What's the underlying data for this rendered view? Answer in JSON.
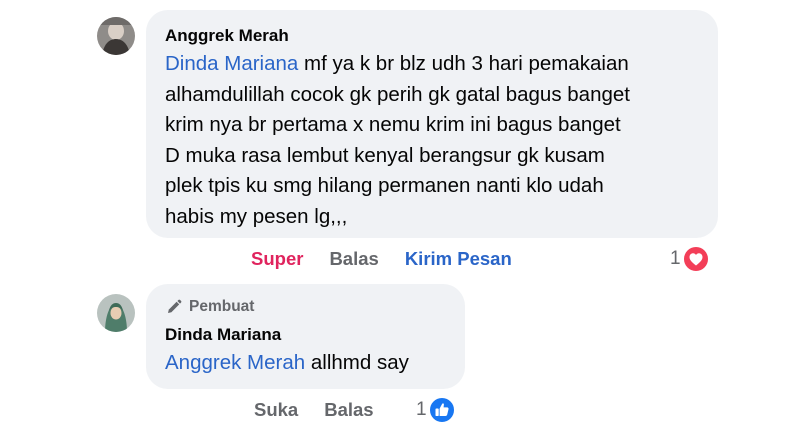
{
  "comment1": {
    "author": "Anggrek Merah",
    "mention": "Dinda Mariana",
    "lines": [
      "mf ya k br blz udh 3 hari pemakaian",
      "alhamdulillah cocok gk perih gk gatal bagus banget",
      "krim nya br pertama x nemu krim ini bagus banget",
      "D muka rasa lembut kenyal berangsur gk kusam",
      "plek tpis ku smg hilang permanen nanti klo udah",
      "habis my pesen lg,,,"
    ],
    "actions": {
      "react_label": "Super",
      "reply_label": "Balas",
      "message_label": "Kirim Pesan"
    },
    "reaction_count": "1",
    "reaction_icon": "heart-icon",
    "reaction_color": "#f33e58"
  },
  "comment2": {
    "badge": "Pembuat",
    "badge_icon": "pencil-icon",
    "author": "Dinda Mariana",
    "mention": "Anggrek Merah",
    "text": "allhmd say",
    "actions": {
      "react_label": "Suka",
      "reply_label": "Balas"
    },
    "reaction_count": "1",
    "reaction_icon": "like-icon",
    "reaction_color": "#1877f2"
  },
  "colors": {
    "bubble": "#f0f2f5",
    "mention": "#2a65c8",
    "muted": "#65676b",
    "super": "#e0245e"
  }
}
